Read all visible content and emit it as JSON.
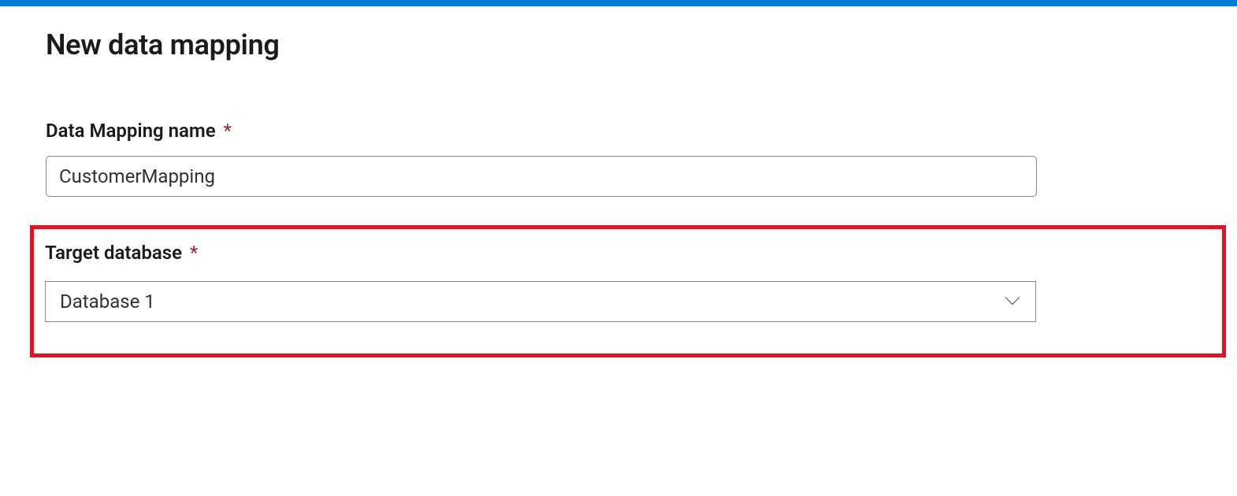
{
  "page": {
    "title": "New data mapping"
  },
  "form": {
    "mapping_name": {
      "label": "Data Mapping name",
      "required_mark": "*",
      "value": "CustomerMapping"
    },
    "target_database": {
      "label": "Target database",
      "required_mark": "*",
      "selected": "Database 1"
    }
  }
}
